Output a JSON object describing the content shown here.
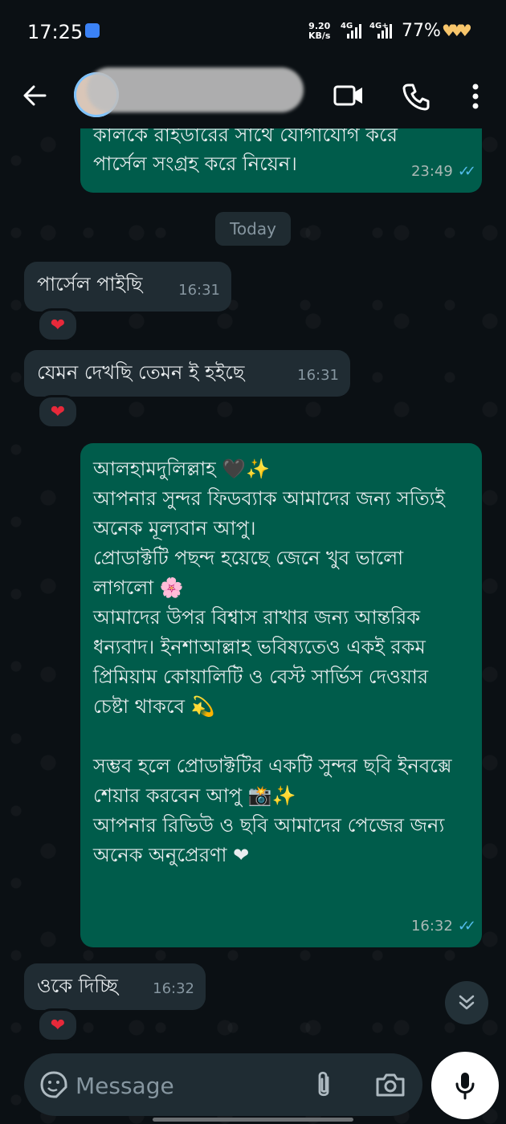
{
  "status_bar": {
    "time": "17:25",
    "net_speed_value": "9.20",
    "net_speed_unit": "KB/s",
    "net_type_1": "4G",
    "net_type_2": "4G+",
    "battery": "77%"
  },
  "header": {
    "back_icon": "arrow-left-icon",
    "video_icon": "video-call-icon",
    "call_icon": "phone-icon",
    "menu_icon": "more-vert-icon"
  },
  "date_chip": "Today",
  "messages": [
    {
      "dir": "out",
      "text": "কালকে রাইডারের সাথে যোগাযোগ করে পার্সেল সংগ্রহ করে নিয়েন।",
      "time": "23:49",
      "read": true
    },
    {
      "dir": "in",
      "text": "পার্সেল পাইছি",
      "time": "16:31",
      "reaction": "❤"
    },
    {
      "dir": "in",
      "text": "যেমন দেখছি তেমন ই হইছে",
      "time": "16:31",
      "reaction": "❤"
    },
    {
      "dir": "out",
      "text": "আলহামদুলিল্লাহ 🖤✨\nআপনার সুন্দর ফিডব্যাক আমাদের জন্য সত্যিই অনেক মূল্যবান আপু।\nপ্রোডাক্টটি পছন্দ হয়েছে জেনে খুব ভালো লাগলো 🌸\nআমাদের উপর বিশ্বাস রাখার জন্য আন্তরিক ধন্যবাদ। ইনশাআল্লাহ ভবিষ্যতেও একই রকম প্রিমিয়াম কোয়ালিটি ও বেস্ট সার্ভিস দেওয়ার চেষ্টা থাকবে 💫\n\nসম্ভব হলে প্রোডাক্টটির একটি সুন্দর ছবি ইনবক্সে শেয়ার করবেন আপু 📸✨\nআপনার রিভিউ ও ছবি আমাদের পেজের জন্য অনেক অনুপ্রেরণা ❤",
      "time": "16:32",
      "read": true
    },
    {
      "dir": "in",
      "text": "ওকে দিচ্ছি",
      "time": "16:32",
      "reaction": "❤"
    }
  ],
  "composer": {
    "placeholder": "Message"
  },
  "colors": {
    "incoming": "#202c33",
    "outgoing": "#005c4b",
    "read_ticks": "#53bdeb",
    "background": "#0b1014"
  }
}
